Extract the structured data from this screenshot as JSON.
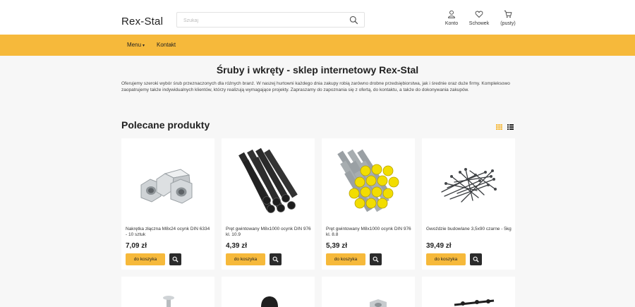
{
  "header": {
    "logo": "Rex-Stal",
    "search_placeholder": "Szukaj",
    "account_label": "Konto",
    "wishlist_label": "Schowek",
    "cart_label": "(pusty)"
  },
  "nav": {
    "menu_label": "Menu",
    "contact_label": "Kontakt"
  },
  "main": {
    "title": "Śruby i wkręty - sklep internetowy Rex-Stal",
    "intro": "Oferujemy szeroki wybór śrub przeznaczonych dla różnych branż. W naszej hurtowni każdego dnia zakupy robią zarówno drobne przedsiębiorstwa, jak i średnie oraz duże firmy. Kompleksowo zaopatrujemy także indywidualnych klientów, którzy realizują wymagające projekty. Zapraszamy do zapoznania się z ofertą, do kontaktu, a także do dokonywania zakupów.",
    "featured_title": "Polecane produkty"
  },
  "colors": {
    "accent": "#f6b93b",
    "dark_button": "#2b2b2b"
  },
  "products": [
    {
      "name": "Nakrętka złączna M8x24 ocynk DIN 6334 - 10 sztuk",
      "price": "7,09 zł",
      "cart_label": "do koszyka",
      "image": "coupling-nut"
    },
    {
      "name": "Pręt gwintowany M8x1000 ocynk DIN 976 kl. 10.9",
      "price": "4,39 zł",
      "cart_label": "do koszyka",
      "image": "threaded-rods-black"
    },
    {
      "name": "Pręt gwintowany M8x1000 ocynk DIN 976 kl. 8.8",
      "price": "5,39 zł",
      "cart_label": "do koszyka",
      "image": "threaded-rods-yellow"
    },
    {
      "name": "Gwoździe budowlane 3,5x90 czarne - 5kg",
      "price": "39,49 zł",
      "cart_label": "do koszyka",
      "image": "nails"
    }
  ]
}
